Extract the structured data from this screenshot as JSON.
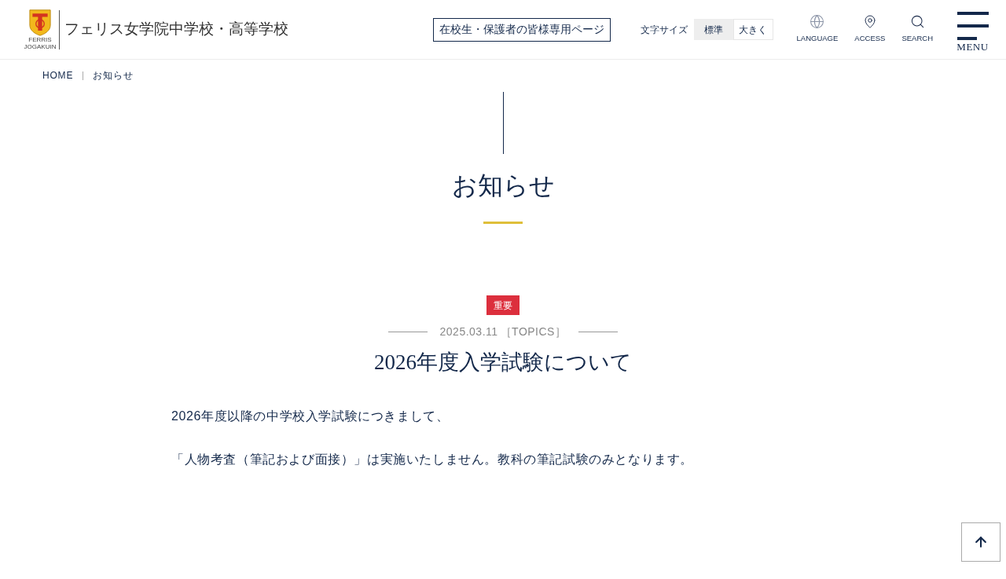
{
  "header": {
    "logo": {
      "lines": [
        "FERRIS",
        "JOGAKUIN"
      ]
    },
    "school_name": "フェリス女学院中学校・高等学校",
    "members_link": "在校生・保護者の皆様専用ページ",
    "font_size": {
      "label": "文字サイズ",
      "options": [
        {
          "label": "標準",
          "selected": true
        },
        {
          "label": "大きく",
          "selected": false
        }
      ]
    },
    "nav": [
      {
        "kind": "language",
        "label": "LANGUAGE"
      },
      {
        "kind": "access",
        "label": "ACCESS"
      },
      {
        "kind": "search",
        "label": "SEARCH"
      }
    ],
    "menu": {
      "label": "MENU"
    }
  },
  "breadcrumb": [
    "HOME",
    "お知らせ"
  ],
  "page_title": "お知らせ",
  "article": {
    "badge": "重要",
    "date": "2025.03.11",
    "category": "［TOPICS］",
    "title": "2026年度入学試験について",
    "paragraphs": [
      "2026年度以降の中学校入学試験につきまして、",
      "「人物考査（筆記および面接）」は実施いたしません。教科の筆記試験のみとなります。"
    ]
  }
}
